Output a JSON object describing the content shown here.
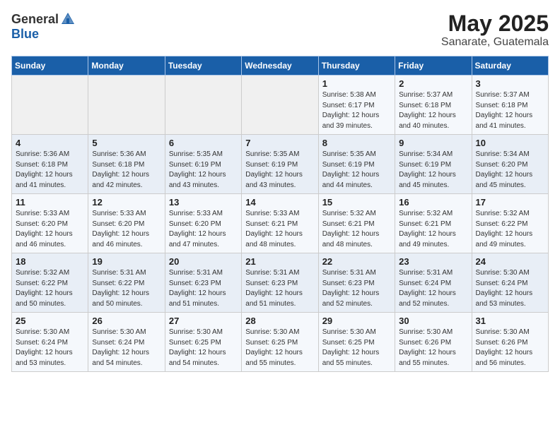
{
  "header": {
    "logo_general": "General",
    "logo_blue": "Blue",
    "month_title": "May 2025",
    "subtitle": "Sanarate, Guatemala"
  },
  "days_of_week": [
    "Sunday",
    "Monday",
    "Tuesday",
    "Wednesday",
    "Thursday",
    "Friday",
    "Saturday"
  ],
  "weeks": [
    [
      {
        "day": "",
        "info": ""
      },
      {
        "day": "",
        "info": ""
      },
      {
        "day": "",
        "info": ""
      },
      {
        "day": "",
        "info": ""
      },
      {
        "day": "1",
        "info": "Sunrise: 5:38 AM\nSunset: 6:17 PM\nDaylight: 12 hours\nand 39 minutes."
      },
      {
        "day": "2",
        "info": "Sunrise: 5:37 AM\nSunset: 6:18 PM\nDaylight: 12 hours\nand 40 minutes."
      },
      {
        "day": "3",
        "info": "Sunrise: 5:37 AM\nSunset: 6:18 PM\nDaylight: 12 hours\nand 41 minutes."
      }
    ],
    [
      {
        "day": "4",
        "info": "Sunrise: 5:36 AM\nSunset: 6:18 PM\nDaylight: 12 hours\nand 41 minutes."
      },
      {
        "day": "5",
        "info": "Sunrise: 5:36 AM\nSunset: 6:18 PM\nDaylight: 12 hours\nand 42 minutes."
      },
      {
        "day": "6",
        "info": "Sunrise: 5:35 AM\nSunset: 6:19 PM\nDaylight: 12 hours\nand 43 minutes."
      },
      {
        "day": "7",
        "info": "Sunrise: 5:35 AM\nSunset: 6:19 PM\nDaylight: 12 hours\nand 43 minutes."
      },
      {
        "day": "8",
        "info": "Sunrise: 5:35 AM\nSunset: 6:19 PM\nDaylight: 12 hours\nand 44 minutes."
      },
      {
        "day": "9",
        "info": "Sunrise: 5:34 AM\nSunset: 6:19 PM\nDaylight: 12 hours\nand 45 minutes."
      },
      {
        "day": "10",
        "info": "Sunrise: 5:34 AM\nSunset: 6:20 PM\nDaylight: 12 hours\nand 45 minutes."
      }
    ],
    [
      {
        "day": "11",
        "info": "Sunrise: 5:33 AM\nSunset: 6:20 PM\nDaylight: 12 hours\nand 46 minutes."
      },
      {
        "day": "12",
        "info": "Sunrise: 5:33 AM\nSunset: 6:20 PM\nDaylight: 12 hours\nand 46 minutes."
      },
      {
        "day": "13",
        "info": "Sunrise: 5:33 AM\nSunset: 6:20 PM\nDaylight: 12 hours\nand 47 minutes."
      },
      {
        "day": "14",
        "info": "Sunrise: 5:33 AM\nSunset: 6:21 PM\nDaylight: 12 hours\nand 48 minutes."
      },
      {
        "day": "15",
        "info": "Sunrise: 5:32 AM\nSunset: 6:21 PM\nDaylight: 12 hours\nand 48 minutes."
      },
      {
        "day": "16",
        "info": "Sunrise: 5:32 AM\nSunset: 6:21 PM\nDaylight: 12 hours\nand 49 minutes."
      },
      {
        "day": "17",
        "info": "Sunrise: 5:32 AM\nSunset: 6:22 PM\nDaylight: 12 hours\nand 49 minutes."
      }
    ],
    [
      {
        "day": "18",
        "info": "Sunrise: 5:32 AM\nSunset: 6:22 PM\nDaylight: 12 hours\nand 50 minutes."
      },
      {
        "day": "19",
        "info": "Sunrise: 5:31 AM\nSunset: 6:22 PM\nDaylight: 12 hours\nand 50 minutes."
      },
      {
        "day": "20",
        "info": "Sunrise: 5:31 AM\nSunset: 6:23 PM\nDaylight: 12 hours\nand 51 minutes."
      },
      {
        "day": "21",
        "info": "Sunrise: 5:31 AM\nSunset: 6:23 PM\nDaylight: 12 hours\nand 51 minutes."
      },
      {
        "day": "22",
        "info": "Sunrise: 5:31 AM\nSunset: 6:23 PM\nDaylight: 12 hours\nand 52 minutes."
      },
      {
        "day": "23",
        "info": "Sunrise: 5:31 AM\nSunset: 6:24 PM\nDaylight: 12 hours\nand 52 minutes."
      },
      {
        "day": "24",
        "info": "Sunrise: 5:30 AM\nSunset: 6:24 PM\nDaylight: 12 hours\nand 53 minutes."
      }
    ],
    [
      {
        "day": "25",
        "info": "Sunrise: 5:30 AM\nSunset: 6:24 PM\nDaylight: 12 hours\nand 53 minutes."
      },
      {
        "day": "26",
        "info": "Sunrise: 5:30 AM\nSunset: 6:24 PM\nDaylight: 12 hours\nand 54 minutes."
      },
      {
        "day": "27",
        "info": "Sunrise: 5:30 AM\nSunset: 6:25 PM\nDaylight: 12 hours\nand 54 minutes."
      },
      {
        "day": "28",
        "info": "Sunrise: 5:30 AM\nSunset: 6:25 PM\nDaylight: 12 hours\nand 55 minutes."
      },
      {
        "day": "29",
        "info": "Sunrise: 5:30 AM\nSunset: 6:25 PM\nDaylight: 12 hours\nand 55 minutes."
      },
      {
        "day": "30",
        "info": "Sunrise: 5:30 AM\nSunset: 6:26 PM\nDaylight: 12 hours\nand 55 minutes."
      },
      {
        "day": "31",
        "info": "Sunrise: 5:30 AM\nSunset: 6:26 PM\nDaylight: 12 hours\nand 56 minutes."
      }
    ]
  ]
}
